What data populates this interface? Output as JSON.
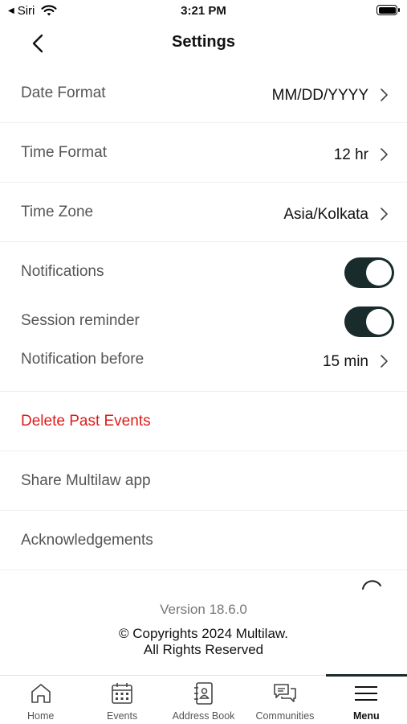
{
  "status_bar": {
    "back_label": "Siri",
    "time": "3:21 PM"
  },
  "nav": {
    "title": "Settings"
  },
  "rows": {
    "date_format": {
      "label": "Date Format",
      "value": "MM/DD/YYYY"
    },
    "time_format": {
      "label": "Time Format",
      "value": "12 hr"
    },
    "time_zone": {
      "label": "Time Zone",
      "value": "Asia/Kolkata"
    }
  },
  "notifications": {
    "notifications_label": "Notifications",
    "notifications_on": true,
    "session_reminder_label": "Session reminder",
    "session_reminder_on": true,
    "notification_before_label": "Notification before",
    "notification_before_value": "15 min"
  },
  "actions": {
    "delete_past_events": "Delete Past Events",
    "share_app": "Share Multilaw app",
    "acknowledgements": "Acknowledgements"
  },
  "footer": {
    "version": "Version 18.6.0",
    "copyright_line1": "© Copyrights 2024 Multilaw.",
    "copyright_line2": "All Rights Reserved"
  },
  "tabs": [
    {
      "label": "Home",
      "icon": "home-icon"
    },
    {
      "label": "Events",
      "icon": "calendar-icon"
    },
    {
      "label": "Address Book",
      "icon": "address-book-icon"
    },
    {
      "label": "Communities",
      "icon": "chat-icon"
    },
    {
      "label": "Menu",
      "icon": "menu-icon",
      "active": true
    }
  ],
  "colors": {
    "toggle_on": "#1a2b2b",
    "danger": "#e01b1b",
    "label_gray": "#555555"
  }
}
